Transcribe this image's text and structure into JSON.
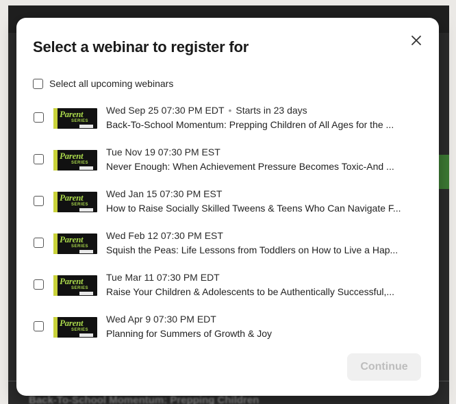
{
  "background": {
    "text_bottom": "Back-To-School Momentum: Prepping Children"
  },
  "modal": {
    "title": "Select a webinar to register for",
    "close_icon": "close-icon",
    "select_all_label": "Select all upcoming webinars",
    "continue_label": "Continue"
  },
  "thumbnail": {
    "word": "Parent",
    "series": "SERIES"
  },
  "webinars": [
    {
      "date": "Wed Sep 25 07:30 PM EDT",
      "starts_in": "Starts in 23 days",
      "title": "Back-To-School Momentum: Prepping Children of All Ages for the ..."
    },
    {
      "date": "Tue Nov 19 07:30 PM EST",
      "starts_in": "",
      "title": "Never Enough: When Achievement Pressure Becomes Toxic-And ..."
    },
    {
      "date": "Wed Jan 15 07:30 PM EST",
      "starts_in": "",
      "title": "How to Raise Socially Skilled Tweens & Teens Who Can Navigate F..."
    },
    {
      "date": "Wed Feb 12 07:30 PM EST",
      "starts_in": "",
      "title": "Squish the Peas: Life Lessons from Toddlers on How to Live a Hap..."
    },
    {
      "date": "Tue Mar 11 07:30 PM EDT",
      "starts_in": "",
      "title": "Raise Your Children & Adolescents to be Authentically Successful,..."
    },
    {
      "date": "Wed Apr 9 07:30 PM EDT",
      "starts_in": "",
      "title": "Planning for Summers of Growth & Joy"
    }
  ],
  "colors": {
    "continue_disabled_bg": "#f0f0f0",
    "continue_disabled_text": "#bdbdbd",
    "thumbnail_green": "#a8d64a"
  }
}
